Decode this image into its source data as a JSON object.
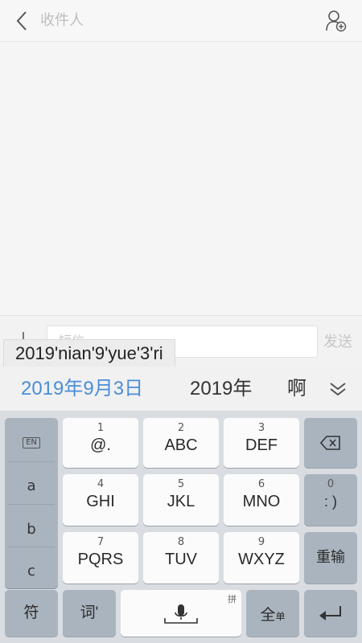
{
  "header": {
    "recipient_placeholder": "收件人"
  },
  "compose": {
    "input_placeholder": "短信",
    "send_label": "发送"
  },
  "ime": {
    "composing_text": "2019'nian'9'yue'3'ri",
    "candidates": [
      "2019年9月3日",
      "2019年",
      "啊"
    ],
    "side_column": {
      "en_label": "EN",
      "letters": [
        "a",
        "b",
        "c"
      ]
    },
    "keys": [
      {
        "num": "1",
        "label": "@."
      },
      {
        "num": "2",
        "label": "ABC"
      },
      {
        "num": "3",
        "label": "DEF"
      },
      {
        "num": "4",
        "label": "GHI"
      },
      {
        "num": "5",
        "label": "JKL"
      },
      {
        "num": "6",
        "label": "MNO"
      },
      {
        "num": "7",
        "label": "PQRS"
      },
      {
        "num": "8",
        "label": "TUV"
      },
      {
        "num": "9",
        "label": "WXYZ"
      }
    ],
    "right_column": {
      "zero_num": "0",
      "zero_label": ": )",
      "reenter_label": "重输"
    },
    "bottom_row": {
      "symbol_label": "符",
      "word_label": "词'",
      "space_badge": "拼",
      "fullwidth_label": "全",
      "fullwidth_sub": "单"
    }
  },
  "colors": {
    "candidate_highlight": "#4a8ed8",
    "keyboard_bg": "#d9dde2",
    "dark_key": "#aab4bf"
  }
}
